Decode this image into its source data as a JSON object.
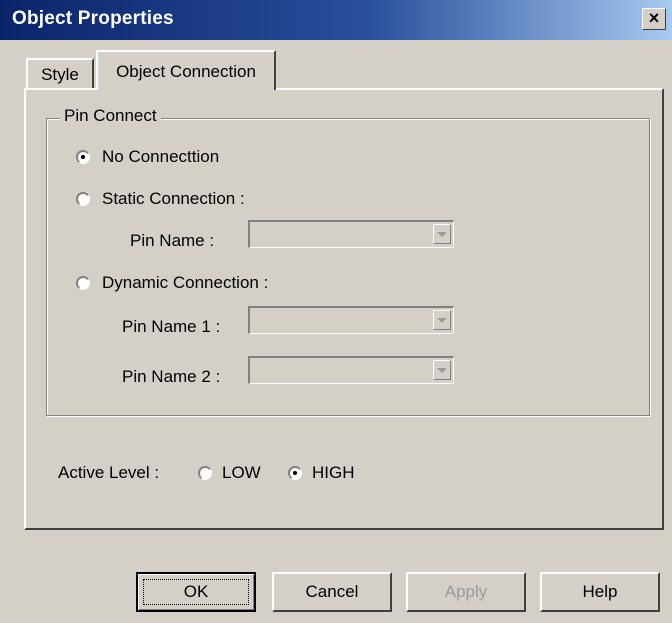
{
  "window": {
    "title": "Object Properties",
    "close_glyph": "×"
  },
  "tabs": [
    {
      "label": "Style",
      "selected": false
    },
    {
      "label": "Object Connection",
      "selected": true
    }
  ],
  "pin_connect": {
    "group_label": "Pin Connect",
    "options": [
      {
        "label": "No Connecttion",
        "checked": true
      },
      {
        "label": "Static Connection :",
        "checked": false
      },
      {
        "label": "Dynamic Connection :",
        "checked": false
      }
    ],
    "static_fields": [
      {
        "label": "Pin Name :",
        "value": ""
      }
    ],
    "dynamic_fields": [
      {
        "label": "Pin Name 1 :",
        "value": ""
      },
      {
        "label": "Pin Name 2 :",
        "value": ""
      }
    ]
  },
  "active_level": {
    "label": "Active Level :",
    "options": [
      {
        "label": "LOW",
        "checked": false
      },
      {
        "label": "HIGH",
        "checked": true
      }
    ]
  },
  "buttons": {
    "ok": "OK",
    "cancel": "Cancel",
    "apply": "Apply",
    "help": "Help"
  },
  "icons": {
    "close": "close-icon",
    "combo_arrow": "chevron-down-icon",
    "radio": "radio-icon"
  },
  "colors": {
    "titlebar_start": "#0a246a",
    "titlebar_end": "#a6caf0",
    "face": "#d4d0c8",
    "disabled_text": "#9a9a9a"
  }
}
